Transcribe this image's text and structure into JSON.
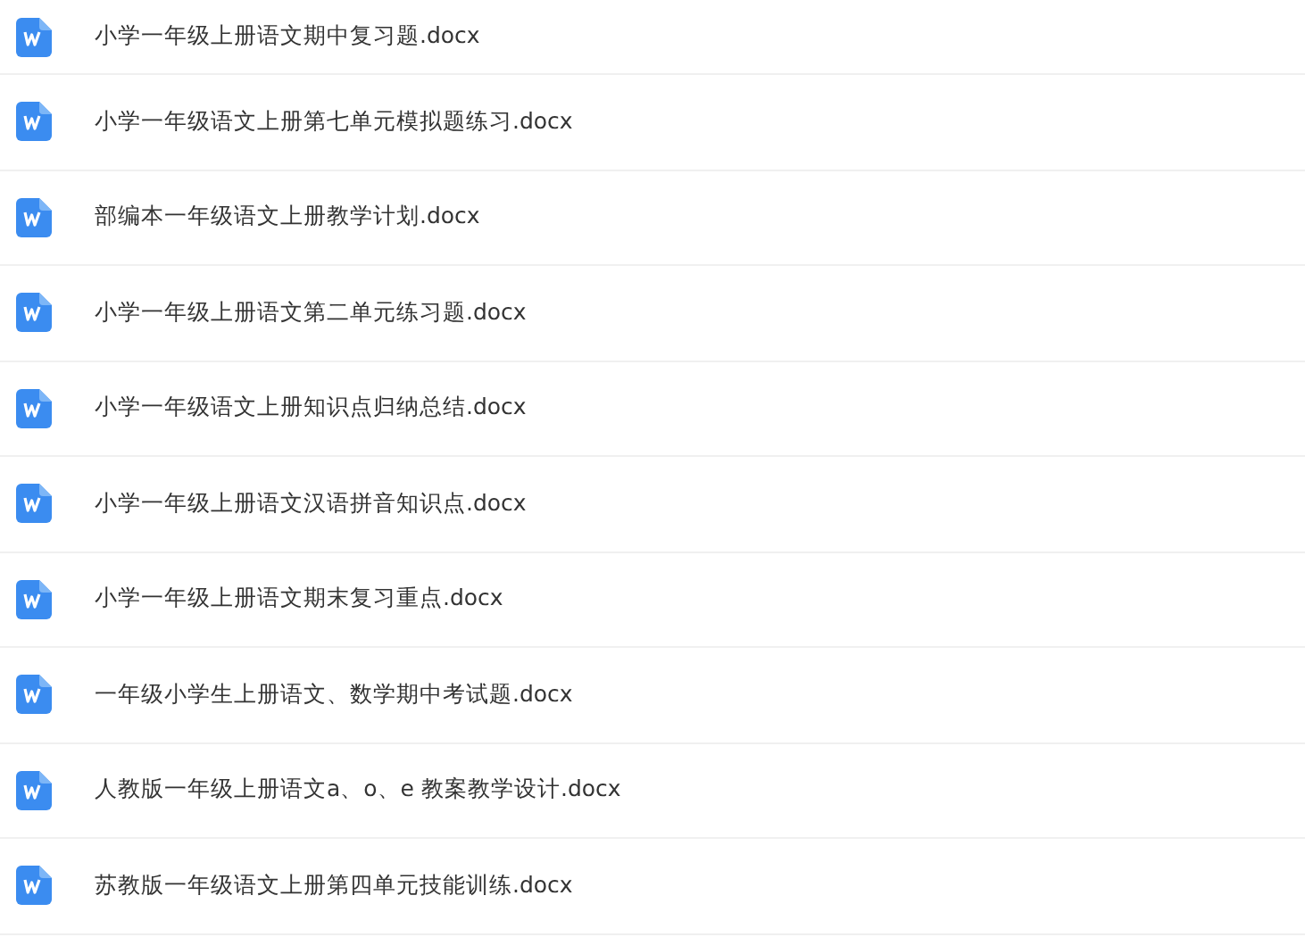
{
  "files": [
    {
      "name": "小学一年级上册语文期中复习题.docx"
    },
    {
      "name": "小学一年级语文上册第七单元模拟题练习.docx"
    },
    {
      "name": "部编本一年级语文上册教学计划.docx"
    },
    {
      "name": "小学一年级上册语文第二单元练习题.docx"
    },
    {
      "name": "小学一年级语文上册知识点归纳总结.docx"
    },
    {
      "name": "小学一年级上册语文汉语拼音知识点.docx"
    },
    {
      "name": "小学一年级上册语文期末复习重点.docx"
    },
    {
      "name": "一年级小学生上册语文、数学期中考试题.docx"
    },
    {
      "name": "人教版一年级上册语文a、o、e 教案教学设计.docx"
    },
    {
      "name": "苏教版一年级语文上册第四单元技能训练.docx"
    }
  ]
}
